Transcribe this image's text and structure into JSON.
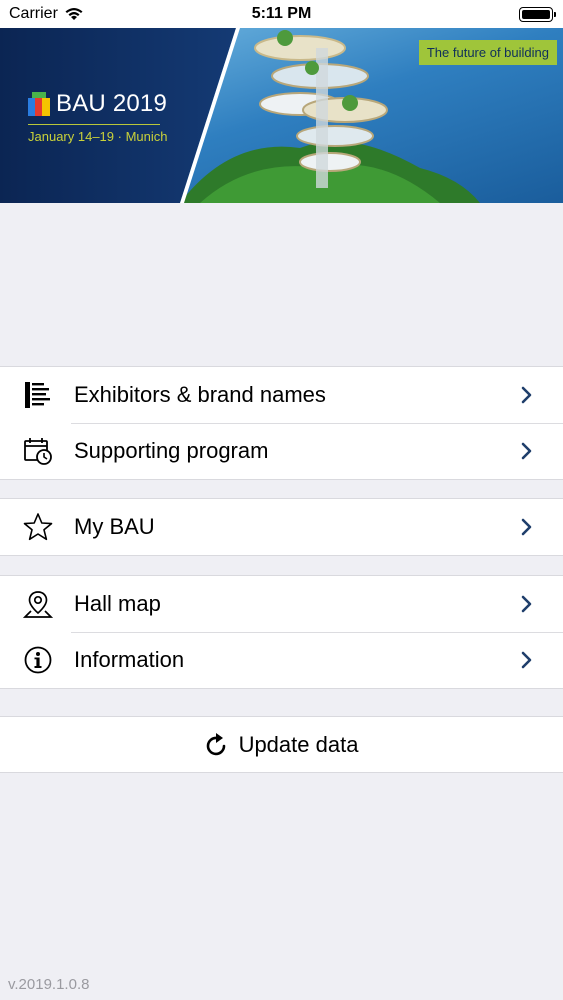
{
  "status_bar": {
    "carrier": "Carrier",
    "time": "5:11 PM",
    "battery_level": 1.0
  },
  "banner": {
    "title": "BAU 2019",
    "subtitle": "January 14–19 · Munich",
    "tagline": "The future of building",
    "colors": {
      "navy": "#0d2a5c",
      "tag_green": "#9fc53a",
      "subtitle_yellow": "#c9d13a"
    }
  },
  "menu": {
    "group1": [
      {
        "label": "Exhibitors & brand names",
        "icon": "list-icon"
      },
      {
        "label": "Supporting program",
        "icon": "calendar-clock-icon"
      }
    ],
    "group2": [
      {
        "label": "My BAU",
        "icon": "star-icon"
      }
    ],
    "group3": [
      {
        "label": "Hall map",
        "icon": "map-pin-icon"
      },
      {
        "label": "Information",
        "icon": "info-icon"
      }
    ],
    "chevron_color": "#1f3e6b"
  },
  "update": {
    "label": "Update data",
    "icon": "refresh-icon"
  },
  "footer": {
    "version": "v.2019.1.0.8"
  }
}
